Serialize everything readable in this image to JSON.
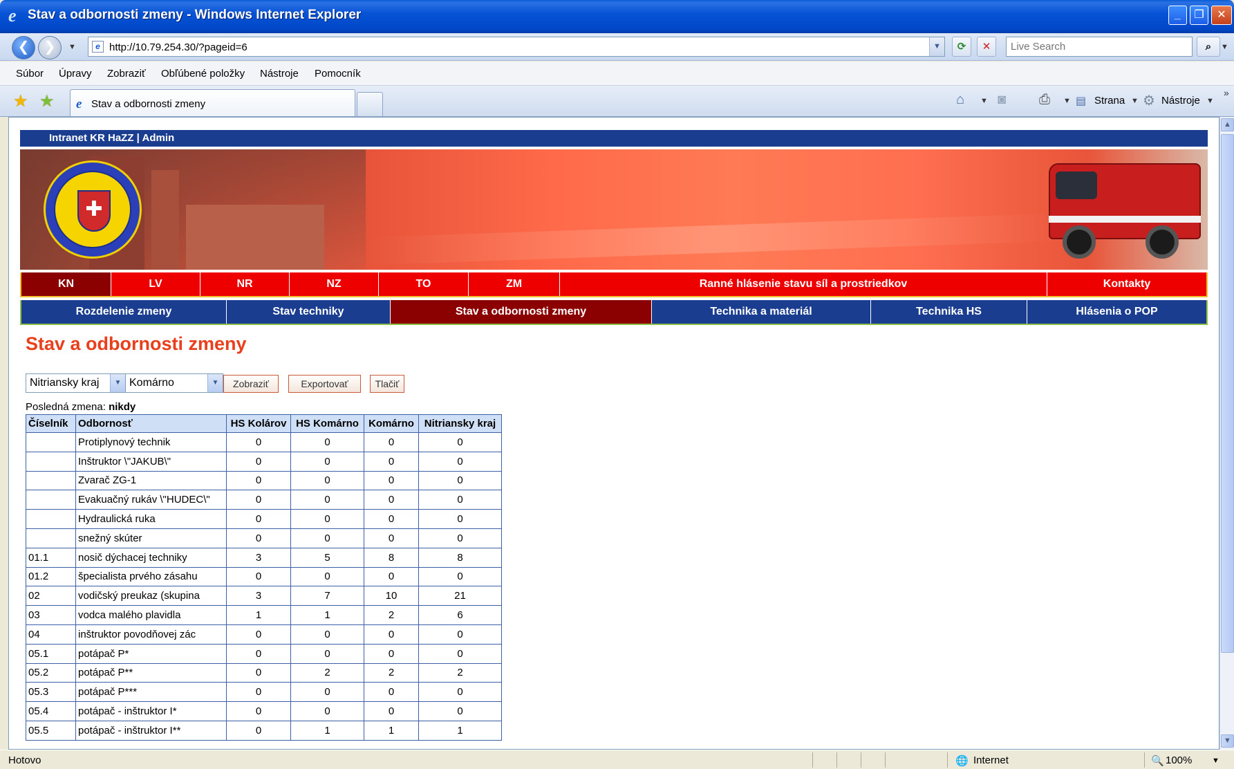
{
  "window": {
    "title": "Stav a odbornosti zmeny - Windows Internet Explorer"
  },
  "address": {
    "url": "http://10.79.254.30/?pageid=6",
    "search_placeholder": "Live Search"
  },
  "menu": [
    "Súbor",
    "Úpravy",
    "Zobraziť",
    "Obľúbené položky",
    "Nástroje",
    "Pomocník"
  ],
  "tab": {
    "label": "Stav a odbornosti zmeny"
  },
  "commandbar": {
    "page": "Strana",
    "tools": "Nástroje"
  },
  "site": {
    "header": "Intranet KR HaZZ | Admin",
    "nav1": [
      {
        "label": "KN",
        "active": true
      },
      {
        "label": "LV",
        "active": false
      },
      {
        "label": "NR",
        "active": false
      },
      {
        "label": "NZ",
        "active": false
      },
      {
        "label": "TO",
        "active": false
      },
      {
        "label": "ZM",
        "active": false
      },
      {
        "label": "Ranné hlásenie stavu síl a prostriedkov",
        "active": false
      },
      {
        "label": "Kontakty",
        "active": false
      }
    ],
    "nav2": [
      {
        "label": "Rozdelenie zmeny",
        "active": false
      },
      {
        "label": "Stav techniky",
        "active": false
      },
      {
        "label": "Stav a odbornosti zmeny",
        "active": true
      },
      {
        "label": "Technika a materiál",
        "active": false
      },
      {
        "label": "Technika HS",
        "active": false
      },
      {
        "label": "Hlásenia o POP",
        "active": false
      }
    ]
  },
  "page": {
    "title": "Stav a odbornosti zmeny",
    "filters": {
      "region": "Nitriansky kraj",
      "district": "Komárno",
      "show_button": "Zobraziť",
      "export_button": "Exportovať",
      "print_button": "Tlačiť"
    },
    "last_shift_label": "Posledná zmena:",
    "last_shift_value": "nikdy"
  },
  "table": {
    "headers": [
      "Číselník",
      "Odbornosť",
      "HS Kolárov",
      "HS Komárno",
      "Komárno",
      "Nitriansky kraj"
    ],
    "rows": [
      [
        "",
        "Protiplynový technik",
        "0",
        "0",
        "0",
        "0"
      ],
      [
        "",
        "Inštruktor \\\"JAKUB\\\"",
        "0",
        "0",
        "0",
        "0"
      ],
      [
        "",
        "Zvarač ZG-1",
        "0",
        "0",
        "0",
        "0"
      ],
      [
        "",
        "Evakuačný rukáv \\\"HUDEC\\\"",
        "0",
        "0",
        "0",
        "0"
      ],
      [
        "",
        "Hydraulická ruka",
        "0",
        "0",
        "0",
        "0"
      ],
      [
        "",
        "snežný skúter",
        "0",
        "0",
        "0",
        "0"
      ],
      [
        "01.1",
        "nosič dýchacej techniky",
        "3",
        "5",
        "8",
        "8"
      ],
      [
        "01.2",
        "špecialista prvého zásahu",
        "0",
        "0",
        "0",
        "0"
      ],
      [
        "02",
        "vodičský preukaz (skupina",
        "3",
        "7",
        "10",
        "21"
      ],
      [
        "03",
        "vodca malého plavidla",
        "1",
        "1",
        "2",
        "6"
      ],
      [
        "04",
        "inštruktor povodňovej zác",
        "0",
        "0",
        "0",
        "0"
      ],
      [
        "05.1",
        "potápač P*",
        "0",
        "0",
        "0",
        "0"
      ],
      [
        "05.2",
        "potápač P**",
        "0",
        "2",
        "2",
        "2"
      ],
      [
        "05.3",
        "potápač P***",
        "0",
        "0",
        "0",
        "0"
      ],
      [
        "05.4",
        "potápač - inštruktor I*",
        "0",
        "0",
        "0",
        "0"
      ],
      [
        "05.5",
        "potápač - inštruktor I**",
        "0",
        "1",
        "1",
        "1"
      ]
    ]
  },
  "status": {
    "left": "Hotovo",
    "zone": "Internet",
    "zoom": "100%"
  }
}
